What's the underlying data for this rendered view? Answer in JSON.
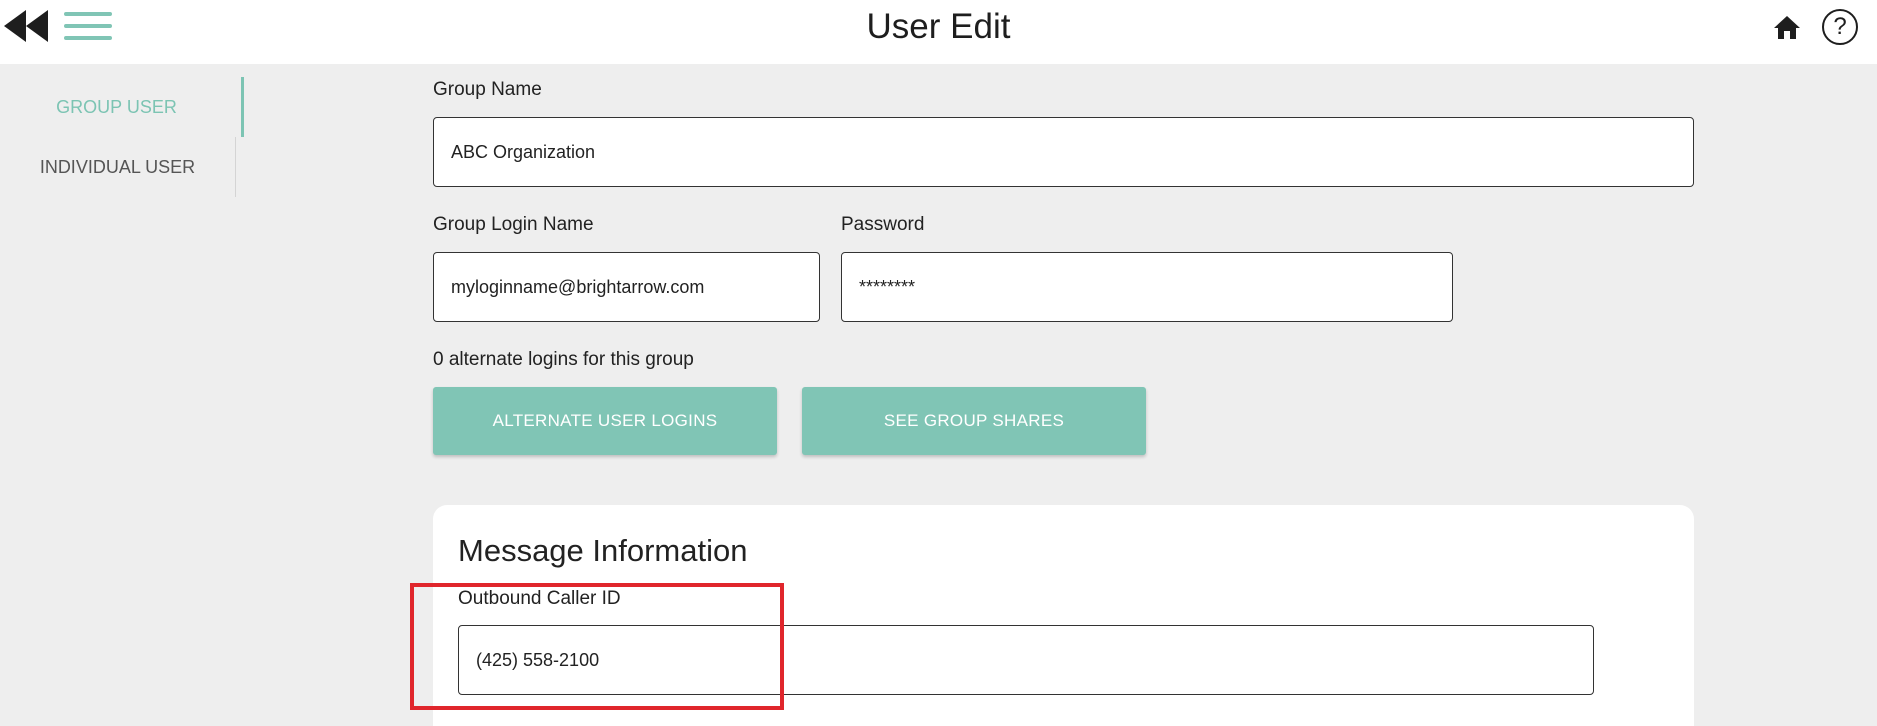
{
  "header": {
    "title": "User Edit",
    "back_icon": "double-chevron-left-icon",
    "menu_icon": "hamburger-menu-icon",
    "home_icon": "home-icon",
    "help_label": "?"
  },
  "sidebar": {
    "items": [
      {
        "label": "GROUP USER",
        "active": true
      },
      {
        "label": "INDIVIDUAL USER",
        "active": false
      }
    ]
  },
  "form": {
    "group_name": {
      "label": "Group Name",
      "value": "ABC Organization"
    },
    "group_login_name": {
      "label": "Group Login Name",
      "value": "myloginname@brightarrow.com"
    },
    "password": {
      "label": "Password",
      "value": "********"
    },
    "alternate_logins_text": "0 alternate logins for this group",
    "alternate_logins_button": "ALTERNATE USER LOGINS",
    "group_shares_button": "SEE GROUP SHARES"
  },
  "message_info": {
    "title": "Message Information",
    "outbound_caller_id": {
      "label": "Outbound Caller ID",
      "value": "(425) 558-2100"
    }
  },
  "colors": {
    "accent": "#80c5b5",
    "background": "#eeeeee",
    "highlight": "#e0262c"
  }
}
